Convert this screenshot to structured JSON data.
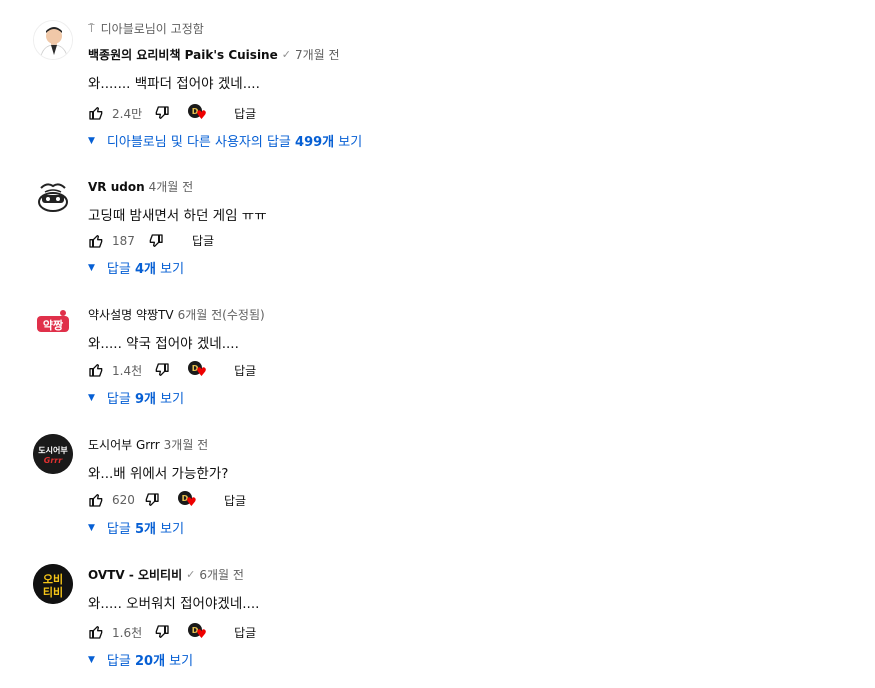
{
  "colors": {
    "link": "#065fd4",
    "secondary": "#606060",
    "heart": "#ee0000"
  },
  "comments": [
    {
      "pinned": "디아블로님이 고정함",
      "author": "백종원의 요리비책 Paik's Cuisine",
      "verified": true,
      "time": "7개월 전",
      "text": "와....... 백파더 접어야 겠네....",
      "likes": "2.4만",
      "creator_heart": true,
      "reply_label": "답글",
      "replies": "디아블로님 및 다른 사용자의 답글 499개 보기"
    },
    {
      "author": "VR udon",
      "verified": false,
      "time": "4개월 전",
      "text": "고딩때 밤새면서 하던 게임 ㅠㅠ",
      "likes": "187",
      "creator_heart": false,
      "reply_label": "답글",
      "replies": "답글 4개 보기"
    },
    {
      "author": "약사설명 약짱TV",
      "verified": false,
      "time": "6개월 전(수정됨)",
      "text": "와..... 약국 접어야 겠네....",
      "likes": "1.4천",
      "creator_heart": true,
      "reply_label": "답글",
      "replies": "답글 9개 보기"
    },
    {
      "author": "도시어부 Grrr",
      "verified": false,
      "time": "3개월 전",
      "text": "와...배 위에서 가능한가?",
      "likes": "620",
      "creator_heart": true,
      "reply_label": "답글",
      "replies": "답글 5개 보기"
    },
    {
      "author": "OVTV - 오비티비",
      "verified": true,
      "time": "6개월 전",
      "text": "와..... 오버워치 접어야겠네....",
      "likes": "1.6천",
      "creator_heart": true,
      "reply_label": "답글",
      "replies": "답글 20개 보기"
    }
  ]
}
